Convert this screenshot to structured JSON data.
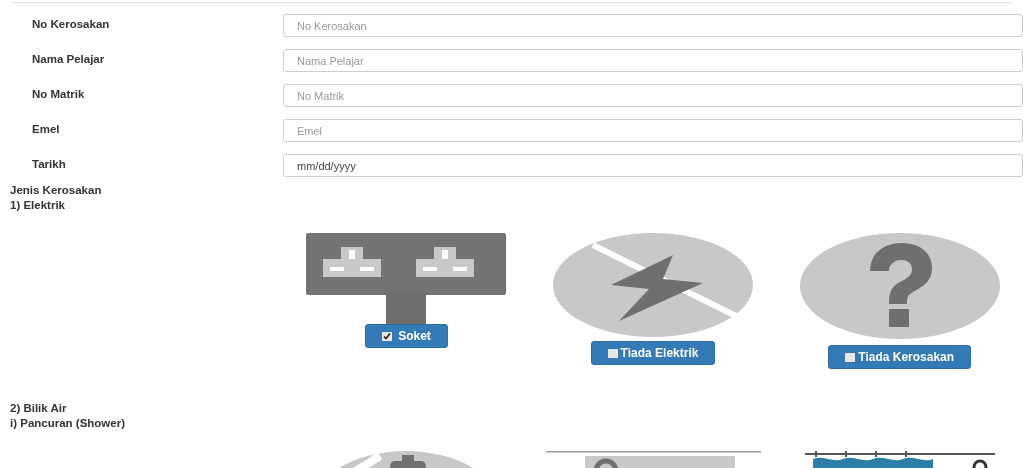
{
  "fields": [
    {
      "label": "No Kerosakan",
      "placeholder": "No Kerosakan",
      "kind": "text"
    },
    {
      "label": "Nama Pelajar",
      "placeholder": "Nama Pelajar",
      "kind": "text"
    },
    {
      "label": "No Matrik",
      "placeholder": "No Matrik",
      "kind": "text"
    },
    {
      "label": "Emel",
      "placeholder": "Emel",
      "kind": "text"
    },
    {
      "label": "Tarikh",
      "value": "mm/dd/yyyy",
      "kind": "date"
    }
  ],
  "heading": "Jenis Kerosakan",
  "sections": [
    {
      "titles": [
        "1) Elektrik"
      ],
      "options": [
        {
          "kind": "socket",
          "label": "Soket",
          "checked": true
        },
        {
          "kind": "no-power",
          "label": "Tiada Elektrik",
          "checked": false
        },
        {
          "kind": "question",
          "label": "Tiada Kerosakan",
          "checked": false
        }
      ]
    },
    {
      "titles": [
        "2) Bilik Air",
        "i) Pancuran (Shower)"
      ],
      "options": [
        {
          "kind": "no-water"
        },
        {
          "kind": "shower"
        },
        {
          "kind": "bath"
        }
      ]
    }
  ]
}
